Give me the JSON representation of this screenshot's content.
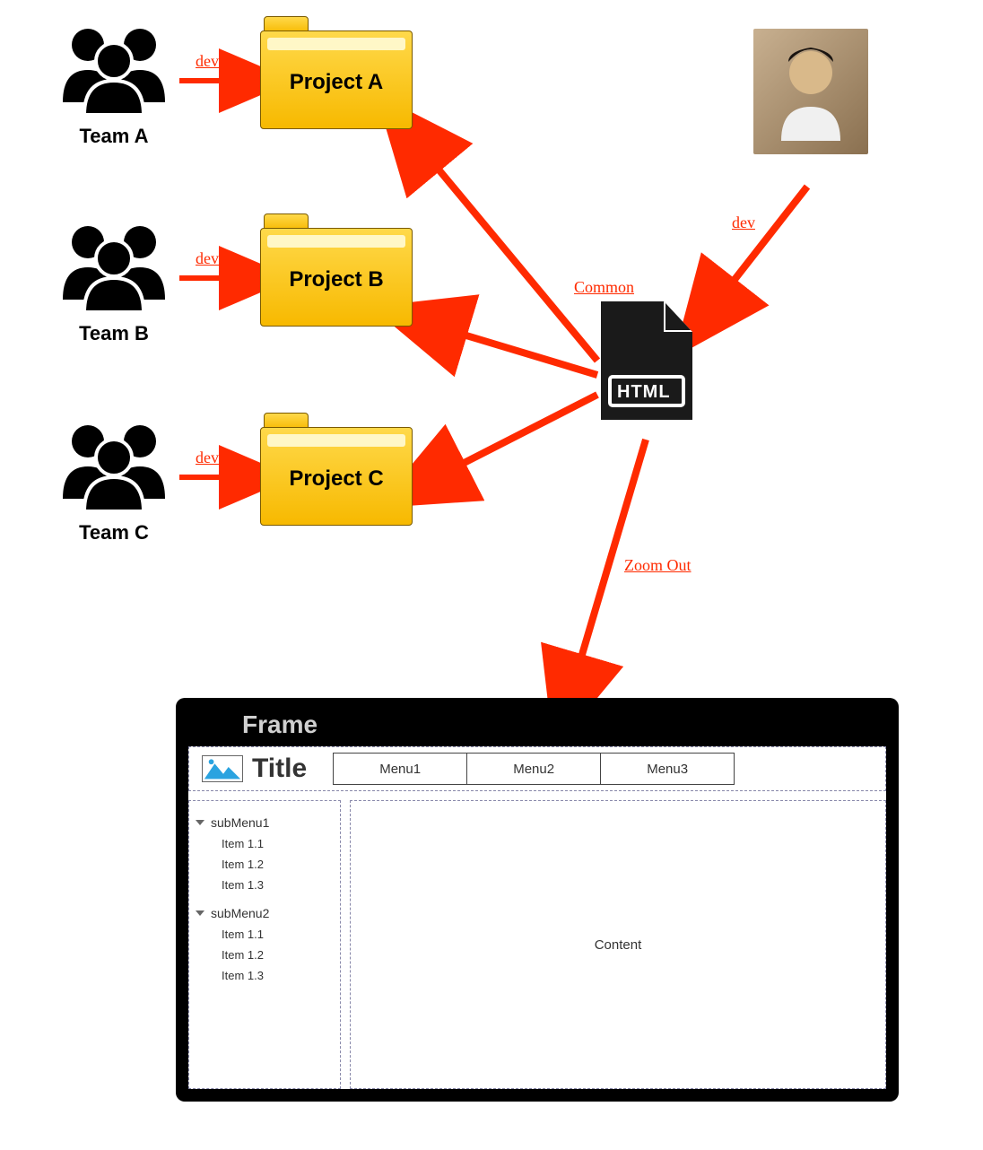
{
  "teams": [
    {
      "label": "Team A",
      "dev": "dev"
    },
    {
      "label": "Team B",
      "dev": "dev"
    },
    {
      "label": "Team C",
      "dev": "dev"
    }
  ],
  "projects": [
    {
      "label": "Project A"
    },
    {
      "label": "Project B"
    },
    {
      "label": "Project C"
    }
  ],
  "developer_arrow_label": "dev",
  "common_label": "Common",
  "html_label": "HTML",
  "zoom_label": "Zoom Out",
  "frame": {
    "title": "Frame",
    "page_title": "Title",
    "menus": [
      "Menu1",
      "Menu2",
      "Menu3"
    ],
    "content_label": "Content",
    "submenus": [
      {
        "name": "subMenu1",
        "items": [
          "Item 1.1",
          "Item 1.2",
          "Item 1.3"
        ]
      },
      {
        "name": "subMenu2",
        "items": [
          "Item 1.1",
          "Item 1.2",
          "Item 1.3"
        ]
      }
    ]
  }
}
